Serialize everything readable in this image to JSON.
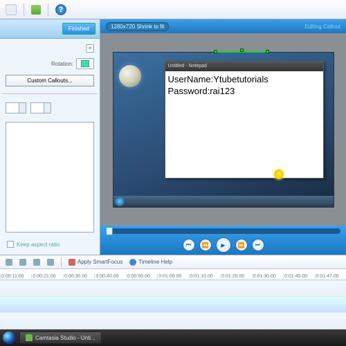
{
  "toolbar": {
    "help_glyph": "?"
  },
  "leftpanel": {
    "finished_label": "Finished",
    "rotation_label": "Rotation:",
    "callouts_label": "Custom Callouts...",
    "keep_aspect_label": "Keep aspect ratio"
  },
  "preview": {
    "dimensions": "1280x720  Shrink to fit",
    "status_right": "Editing Callout",
    "notepad": {
      "title": "Untitled - Notepad",
      "line1": "UserName:Ytubetutorials",
      "line2": "Password:rai123"
    }
  },
  "playback": {
    "prev": "⏮",
    "rew": "⏪",
    "play": "▶",
    "fwd": "⏩",
    "next": "⏭"
  },
  "timeline": {
    "apply_smartfocus": "Apply SmartFocus",
    "timeline_help": "Timeline Help",
    "ticks": [
      "0:00:11.00",
      "0:00:21.00",
      "0:00:30.00",
      "0:00:40.00",
      "0:00:50.00",
      "0:01:00.00",
      "0:01:10.00",
      "0:01:20.00",
      "0:01:30.00",
      "0:01:40.00",
      "0:01:47.00"
    ]
  },
  "taskbar": {
    "app_label": "Camtasia Studio - Unti..."
  }
}
